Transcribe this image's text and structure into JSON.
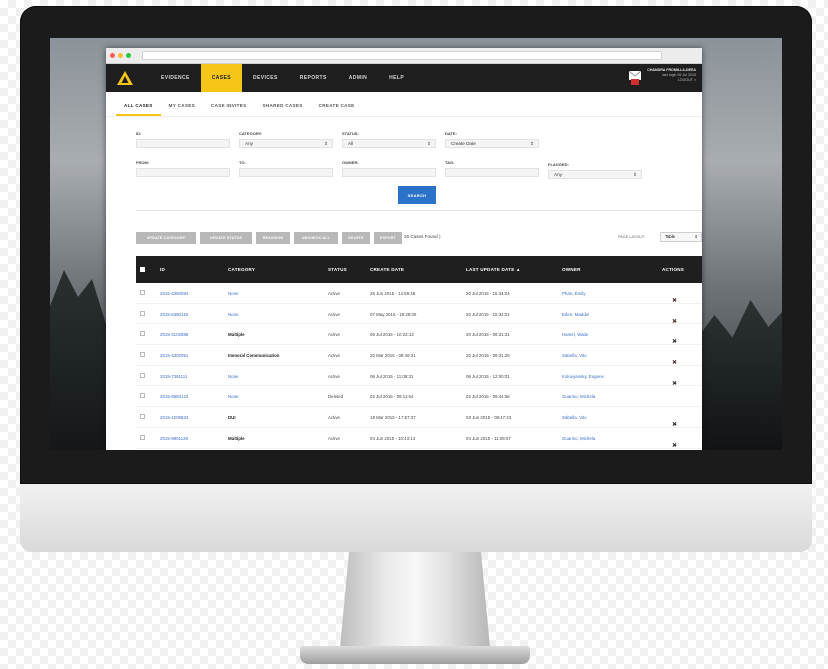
{
  "navbar": {
    "items": [
      {
        "label": "EVIDENCE",
        "active": false
      },
      {
        "label": "CASES",
        "active": true
      },
      {
        "label": "DEVICES",
        "active": false
      },
      {
        "label": "REPORTS",
        "active": false
      },
      {
        "label": "ADMIN",
        "active": false
      },
      {
        "label": "HELP",
        "active": false
      }
    ],
    "user_name": "CHANDRA FROMILLA-DEEA",
    "user_line2": "last login 05 Jul 2015",
    "user_line3": "LOGOUT >"
  },
  "tabs": [
    {
      "label": "ALL CASES",
      "active": true
    },
    {
      "label": "MY CASES",
      "active": false
    },
    {
      "label": "CASE INVITES",
      "active": false
    },
    {
      "label": "SHARED CASES",
      "active": false
    },
    {
      "label": "CREATE CASE",
      "active": false
    }
  ],
  "filters": {
    "id_label": "ID:",
    "category_label": "CATEGORY:",
    "category_value": "Any",
    "status_label": "STATUS:",
    "status_value": "All",
    "date_label": "DATE:",
    "date_value": "Create Date",
    "from_label": "FROM:",
    "to_label": "TO:",
    "owner_label": "OWNER:",
    "tag_label": "TAG:",
    "flagged_label": "FLAGGED:",
    "flagged_value": "Any",
    "search_label": "SEARCH"
  },
  "actions": {
    "buttons": [
      "UPDATE CATEGORY",
      "UPDATE STATUS",
      "REASSIGN",
      "UNCHECK ALL",
      "DELETE",
      "EXPORT"
    ],
    "found_text": "26 Cases Found )",
    "page_layout_label": "PAGE LAYOUT:",
    "page_layout_value": "Table"
  },
  "table": {
    "headers": {
      "id": "ID",
      "category": "CATEGORY",
      "status": "STATUS",
      "create_date": "CREATE DATE",
      "last_update": "LAST UPDATE DATE ▲",
      "owner": "OWNER",
      "actions": "ACTIONS"
    },
    "rows": [
      {
        "id": "2015-4350094",
        "category": "None",
        "status": "Active",
        "create": "25 Jun 2015 - 14:59:48",
        "update": "20 Jul 2015 - 15:34:04",
        "owner": "Phan, Emily",
        "pin": "red"
      },
      {
        "id": "2015-6390119",
        "category": "None",
        "status": "Active",
        "create": "07 May 2015 - 19:28:00",
        "update": "20 Jul 2015 - 15:34:01",
        "owner": "Eden, Maddie",
        "pin": "red"
      },
      {
        "id": "2015-3102888",
        "category": "Multiple",
        "status": "Active",
        "create": "06 Jul 2015 - 10:23:13",
        "update": "20 Jul 2015 - 09:31:31",
        "owner": "Hamel, Wade",
        "pin": "dark"
      },
      {
        "id": "2015-4302091",
        "category": "Immoral Communication",
        "status": "Active",
        "create": "20 Mar 2015 - 08:49:31",
        "update": "20 Jul 2015 - 09:31:26",
        "owner": "Sabella, Vito",
        "pin": "red"
      },
      {
        "id": "2015-7381111",
        "category": "None",
        "status": "Active",
        "create": "06 Jul 2015 - 11:08:31",
        "update": "06 Jul 2015 - 12:00:01",
        "owner": "Kolovyansky, Eugene",
        "pin": "dark"
      },
      {
        "id": "2015-6893123",
        "category": "None",
        "status": "Deleted",
        "create": "02 Jul 2015 - 09:11:54",
        "update": "02 Jul 2015 - 09:44:56",
        "owner": "Guarino, Michela",
        "pin": "none"
      },
      {
        "id": "2015-4209834",
        "category": "DUI",
        "status": "Active",
        "create": "19 Mar 2015 - 17:57:37",
        "update": "03 Jun 2015 - 08:47:43",
        "owner": "Sabella, Vito",
        "pin": "dark"
      },
      {
        "id": "2015-9801128",
        "category": "Multiple",
        "status": "Active",
        "create": "04 Jun 2015 - 10:43:14",
        "update": "04 Jun 2015 - 11:09:57",
        "owner": "Guarino, Michela",
        "pin": "dark"
      }
    ]
  },
  "colors": {
    "accent": "#f5c518",
    "nav_bg": "#1e1e1e",
    "link": "#3b6dc4",
    "search_button": "#2b73c8",
    "pin_red": "#d32f2f"
  }
}
